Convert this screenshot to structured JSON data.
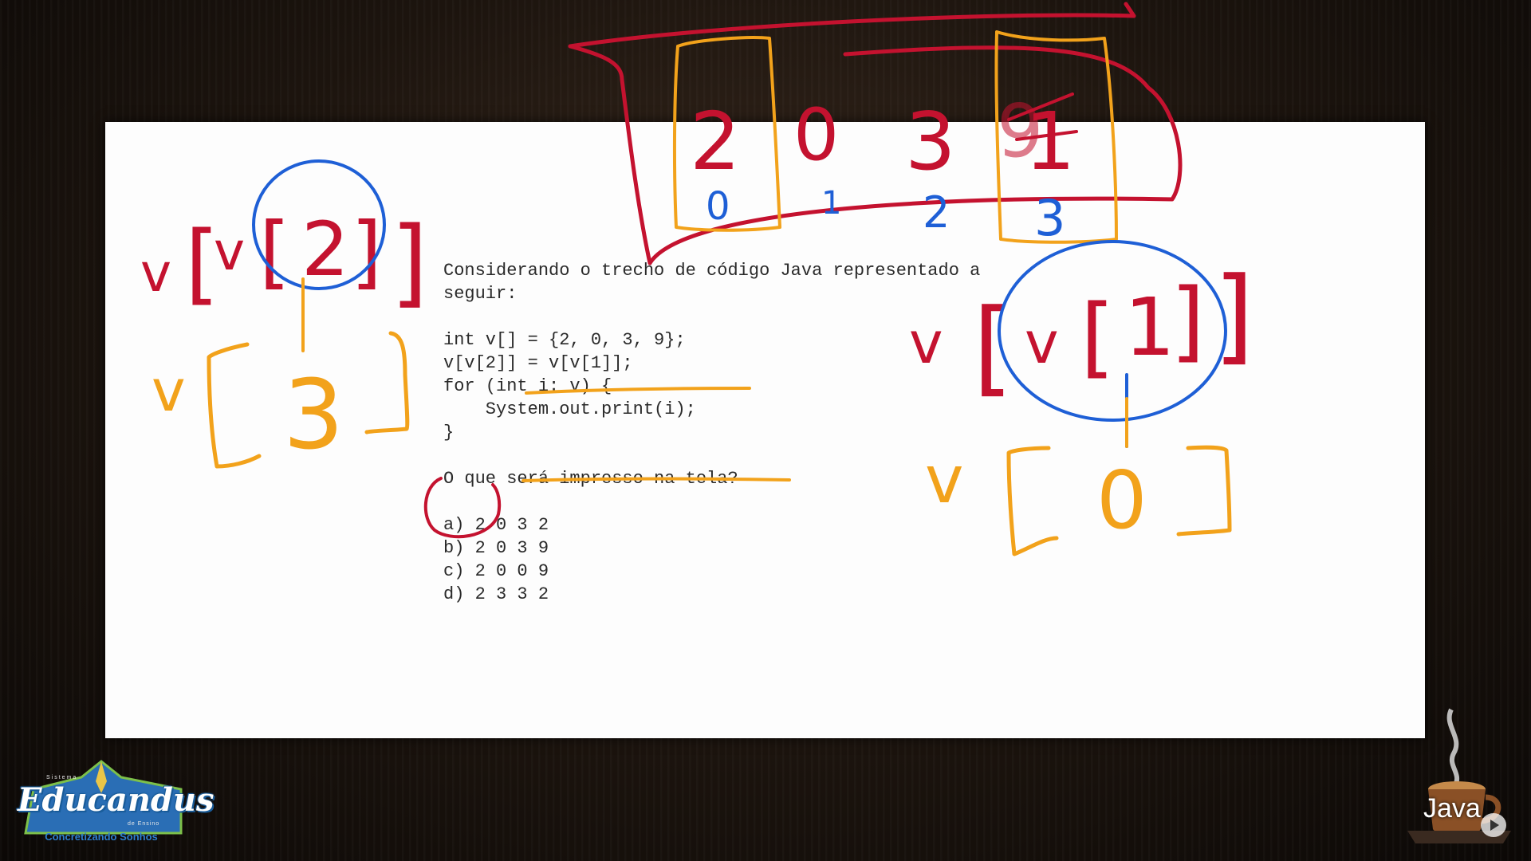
{
  "slide": {
    "intro_line1": "Considerando o trecho de código Java representado a",
    "intro_line2": "seguir:",
    "code": [
      "int v[] = {2, 0, 3, 9};",
      "v[v[2]] = v[v[1]];",
      "for (int i: v) {",
      "    System.out.print(i);",
      "}"
    ],
    "question": "O que será impresso na tela?",
    "options": [
      "a) 2 0 3 2",
      "b) 2 0 3 9",
      "c) 2 0 0 9",
      "d) 2 3 3 2"
    ]
  },
  "annotations": {
    "array_values": [
      "2",
      "0",
      "3",
      "1"
    ],
    "overwritten_value": "9",
    "array_indices": [
      "0",
      "1",
      "2",
      "3"
    ],
    "left_expr": [
      "v",
      "[",
      "v",
      "[",
      "2",
      "]",
      "]"
    ],
    "left_result": [
      "v",
      "[",
      "3",
      "]"
    ],
    "right_expr": [
      "v",
      "[",
      "v",
      "[",
      "1",
      "]",
      "]"
    ],
    "right_result": [
      "v",
      "[",
      "0",
      "]"
    ],
    "colors": {
      "red": "#c4122f",
      "blue": "#1e5fd6",
      "orange": "#f2a21b"
    }
  },
  "branding": {
    "logo_name": "Educandus",
    "logo_top": "Sistema",
    "logo_small": "de Ensino",
    "logo_tagline": "Concretizando Sonhos",
    "java_label": "Java",
    "icons": [
      "coffee-cup-icon",
      "play-icon"
    ]
  }
}
